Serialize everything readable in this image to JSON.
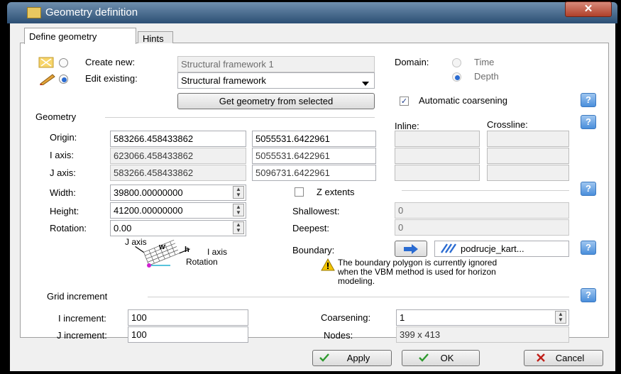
{
  "window": {
    "title": "Geometry definition",
    "close_label": "✕"
  },
  "tabs": [
    {
      "label": "Define geometry"
    },
    {
      "label": "Hints"
    }
  ],
  "create_new": {
    "label": "Create new:",
    "value": "Structural framework 1"
  },
  "edit_existing": {
    "label": "Edit existing:",
    "value": "Structural framework"
  },
  "get_geometry_button": "Get geometry from selected",
  "domain": {
    "label": "Domain:",
    "time": "Time",
    "depth": "Depth"
  },
  "auto_coarsening": "Automatic coarsening",
  "geometry": {
    "section": "Geometry",
    "inline_header": "Inline:",
    "crossline_header": "Crossline:",
    "origin": {
      "label": "Origin:",
      "x": "583266.458433862",
      "y": "5055531.6422961"
    },
    "i_axis": {
      "label": "I axis:",
      "x": "623066.458433862",
      "y": "5055531.6422961"
    },
    "j_axis": {
      "label": "J axis:",
      "x": "583266.458433862",
      "y": "5096731.6422961"
    },
    "width": {
      "label": "Width:",
      "value": "39800.00000000"
    },
    "height": {
      "label": "Height:",
      "value": "41200.00000000"
    },
    "rotation": {
      "label": "Rotation:",
      "value": "0.00"
    },
    "diagram": {
      "j_axis": "J axis",
      "i_axis": "I axis",
      "w": "w",
      "h": "h",
      "rotation": "Rotation"
    }
  },
  "z_extents": {
    "label": "Z extents",
    "shallowest": {
      "label": "Shallowest:",
      "value": "0"
    },
    "deepest": {
      "label": "Deepest:",
      "value": "0"
    }
  },
  "boundary": {
    "label": "Boundary:",
    "value": "podrucje_kart...",
    "warning": "The boundary polygon is currently ignored when the VBM method is used for horizon modeling."
  },
  "grid_increment": {
    "section": "Grid increment",
    "i_label": "I increment:",
    "i_value": "100",
    "j_label": "J increment:",
    "j_value": "100",
    "coarsening_label": "Coarsening:",
    "coarsening_value": "1",
    "nodes_label": "Nodes:",
    "nodes_value": "399 x 413"
  },
  "buttons": {
    "apply": "Apply",
    "ok": "OK",
    "cancel": "Cancel"
  },
  "help_label": "?",
  "colors": {
    "accent": "#2a6bd1",
    "check_green": "#2e9a2e",
    "cancel_red": "#c0201a",
    "titlebar": "#3f6086"
  }
}
